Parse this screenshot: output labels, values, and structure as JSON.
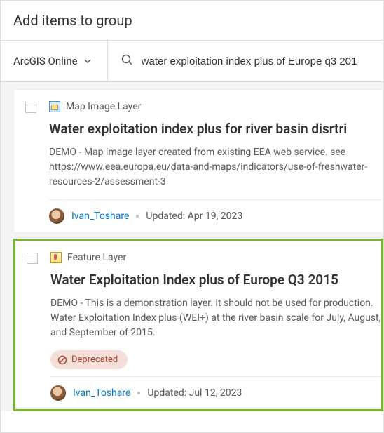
{
  "dialog": {
    "title": "Add items to group"
  },
  "toolbar": {
    "scope_label": "ArcGIS Online",
    "search_value": "water exploitation index plus of Europe q3 201"
  },
  "results": [
    {
      "type_label": "Map Image Layer",
      "title": "Water exploitation index plus for river basin disrtri",
      "description": "DEMO - Map image layer created from existing EEA web service. see https://www.eea.europa.eu/data-and-maps/indicators/use-of-freshwater-resources-2/assessment-3",
      "author": "Ivan_Toshare",
      "updated": "Updated: Apr 19, 2023",
      "deprecated": false,
      "selected": false
    },
    {
      "type_label": "Feature Layer",
      "title": "Water Exploitation Index plus of Europe Q3 2015",
      "description": "DEMO - This is a demonstration layer. It should not be used for production. Water Exploitation Index plus (WEI+) at the river basin scale for July, August, and September of 2015.",
      "author": "Ivan_Toshare",
      "updated": "Updated: Jul 12, 2023",
      "deprecated": true,
      "deprecated_label": "Deprecated",
      "selected": true
    }
  ]
}
